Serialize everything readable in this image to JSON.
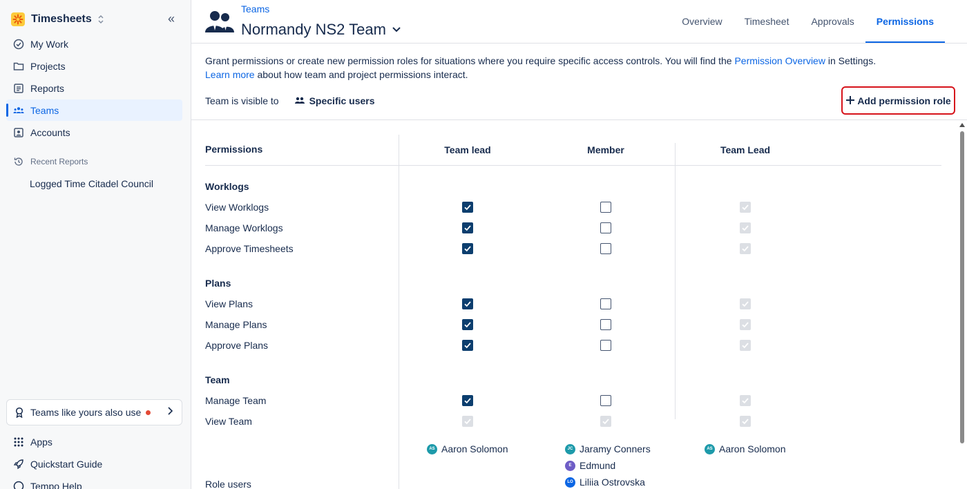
{
  "app": {
    "title": "Timesheets",
    "collapse_icon": "«"
  },
  "sidebar": {
    "items": [
      {
        "label": "My Work",
        "icon": "check-circle-icon"
      },
      {
        "label": "Projects",
        "icon": "folder-icon"
      },
      {
        "label": "Reports",
        "icon": "report-icon"
      },
      {
        "label": "Teams",
        "icon": "people-icon",
        "active": true
      },
      {
        "label": "Accounts",
        "icon": "account-icon"
      }
    ],
    "recent_label": "Recent Reports",
    "recent_items": [
      "Logged Time Citadel Council"
    ],
    "promo": "Teams like yours also use",
    "bottom_items": [
      {
        "label": "Apps",
        "icon": "apps-grid-icon"
      },
      {
        "label": "Quickstart Guide",
        "icon": "rocket-icon"
      },
      {
        "label": "Tempo Help",
        "icon": "help-icon"
      }
    ]
  },
  "header": {
    "breadcrumb": "Teams",
    "team_name": "Normandy NS2 Team",
    "tabs": [
      "Overview",
      "Timesheet",
      "Approvals",
      "Permissions"
    ],
    "active_tab": "Permissions"
  },
  "intro": {
    "text_before_link1": "Grant permissions or create new permission roles for situations where you require specific access controls. You will find the ",
    "link1": "Permission Overview",
    "text_after_link1": " in Settings.",
    "link2": "Learn more",
    "text_after_link2": " about how team and project permissions interact."
  },
  "visibility": {
    "label": "Team is visible to",
    "value": "Specific users"
  },
  "add_role_button": "Add permission role",
  "permissions": {
    "header": "Permissions",
    "columns": [
      "Team lead",
      "Member",
      "Team Lead"
    ],
    "groups": [
      {
        "title": "Worklogs",
        "rows": [
          {
            "label": "View Worklogs",
            "states": [
              "checked",
              "unchecked",
              "disabled"
            ]
          },
          {
            "label": "Manage Worklogs",
            "states": [
              "checked",
              "unchecked",
              "disabled"
            ]
          },
          {
            "label": "Approve Timesheets",
            "states": [
              "checked",
              "unchecked",
              "disabled"
            ]
          }
        ]
      },
      {
        "title": "Plans",
        "rows": [
          {
            "label": "View Plans",
            "states": [
              "checked",
              "unchecked",
              "disabled"
            ]
          },
          {
            "label": "Manage Plans",
            "states": [
              "checked",
              "unchecked",
              "disabled"
            ]
          },
          {
            "label": "Approve Plans",
            "states": [
              "checked",
              "unchecked",
              "disabled"
            ]
          }
        ]
      },
      {
        "title": "Team",
        "rows": [
          {
            "label": "Manage Team",
            "states": [
              "checked",
              "unchecked",
              "disabled"
            ]
          },
          {
            "label": "View Team",
            "states": [
              "disabled",
              "disabled",
              "disabled"
            ]
          }
        ]
      }
    ],
    "role_users_label": "Role users",
    "role_users": [
      [
        {
          "initials": "AS",
          "name": "Aaron Solomon",
          "color": "#1d9aaa"
        }
      ],
      [
        {
          "initials": "JC",
          "name": "Jaramy Conners",
          "color": "#1d9aaa"
        },
        {
          "initials": "E",
          "name": "Edmund",
          "color": "#6e5dc6"
        },
        {
          "initials": "LO",
          "name": "Liliia Ostrovska",
          "color": "#0c66e4"
        }
      ],
      [
        {
          "initials": "AS",
          "name": "Aaron Solomon",
          "color": "#1d9aaa"
        }
      ]
    ]
  },
  "colors": {
    "accent": "#0c66e4",
    "checkbox_checked": "#0c3e6e",
    "highlight_border": "#d6131b"
  }
}
